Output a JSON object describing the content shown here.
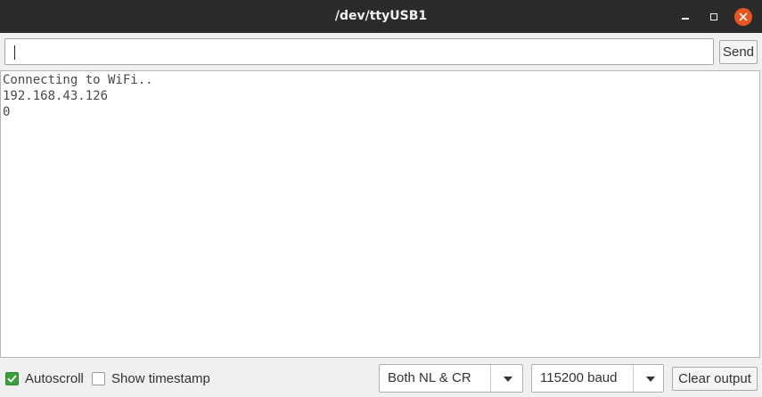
{
  "window": {
    "title": "/dev/ttyUSB1",
    "close_color": "#e95420",
    "titlebar_color": "#2b2b2b"
  },
  "send_row": {
    "input_value": "",
    "send_label": "Send"
  },
  "output": {
    "lines": [
      "Connecting to WiFi..",
      "192.168.43.126",
      "0"
    ]
  },
  "footer": {
    "autoscroll": {
      "label": "Autoscroll",
      "checked": true,
      "color": "#38a13a"
    },
    "timestamp": {
      "label": "Show timestamp",
      "checked": false
    },
    "line_ending": {
      "selected": "Both NL & CR"
    },
    "baud_rate": {
      "selected": "115200 baud"
    },
    "clear_label": "Clear output"
  },
  "icons": {
    "minimize": "minimize-icon",
    "maximize": "maximize-icon",
    "close": "close-icon",
    "check": "check-icon",
    "dropdown": "chevron-down-icon"
  }
}
